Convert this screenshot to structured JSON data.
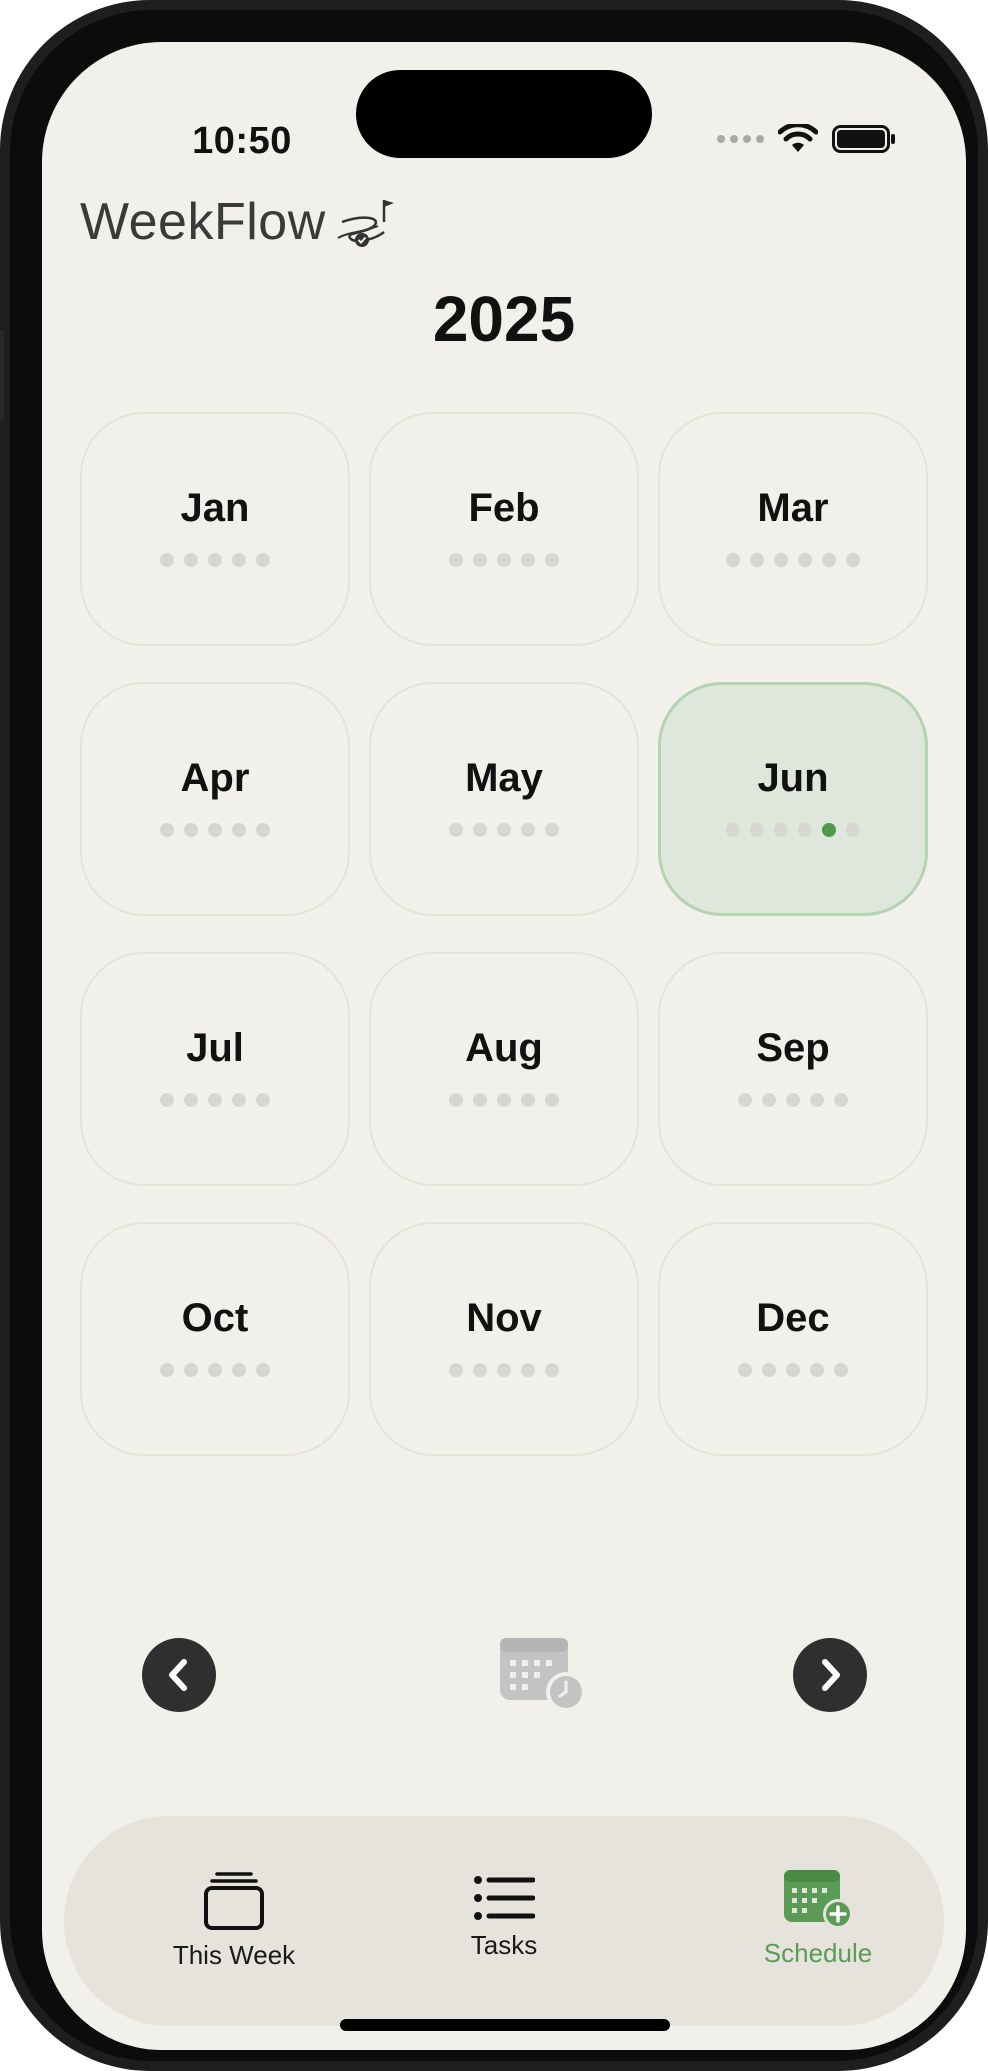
{
  "status_bar": {
    "time": "10:50"
  },
  "header": {
    "app_name": "WeekFlow"
  },
  "year": "2025",
  "months": [
    {
      "label": "Jan",
      "weeks": 5,
      "active_week": null
    },
    {
      "label": "Feb",
      "weeks": 5,
      "active_week": null
    },
    {
      "label": "Mar",
      "weeks": 6,
      "active_week": null
    },
    {
      "label": "Apr",
      "weeks": 5,
      "active_week": null
    },
    {
      "label": "May",
      "weeks": 5,
      "active_week": null
    },
    {
      "label": "Jun",
      "weeks": 6,
      "active_week": 5,
      "current": true
    },
    {
      "label": "Jul",
      "weeks": 5,
      "active_week": null
    },
    {
      "label": "Aug",
      "weeks": 5,
      "active_week": null
    },
    {
      "label": "Sep",
      "weeks": 5,
      "active_week": null
    },
    {
      "label": "Oct",
      "weeks": 5,
      "active_week": null
    },
    {
      "label": "Nov",
      "weeks": 5,
      "active_week": null
    },
    {
      "label": "Dec",
      "weeks": 5,
      "active_week": null
    }
  ],
  "navigation": {
    "prev_icon": "chevron-left-icon",
    "today_icon": "calendar-clock-icon",
    "next_icon": "chevron-right-icon"
  },
  "tabbar": {
    "tabs": [
      {
        "label": "This Week",
        "icon": "stack-icon"
      },
      {
        "label": "Tasks",
        "icon": "list-icon"
      },
      {
        "label": "Schedule",
        "icon": "calendar-add-icon",
        "active": true
      }
    ]
  },
  "colors": {
    "background": "#f2f0ea",
    "accent_green": "#5a9c55",
    "current_month_fill": "#dfe7dc",
    "current_month_border": "#b4d3af",
    "dark_button": "#2f2f2f"
  }
}
